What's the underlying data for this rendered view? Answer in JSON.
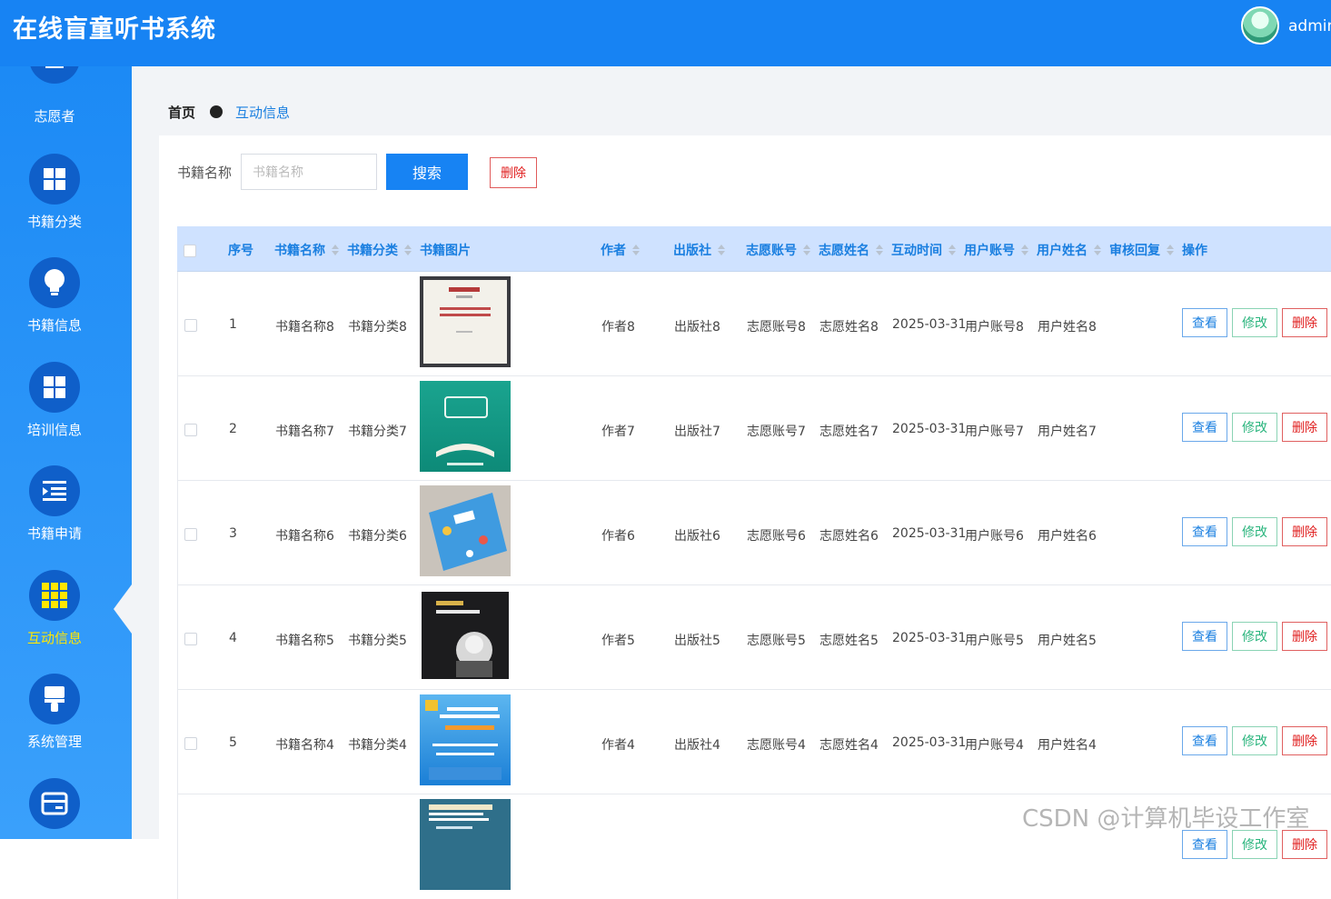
{
  "app": {
    "title": "在线盲童听书系统",
    "user": "admin"
  },
  "sidebar": {
    "items": [
      {
        "label": "志愿者",
        "icon": "volunteer-icon"
      },
      {
        "label": "书籍分类",
        "icon": "grid-icon"
      },
      {
        "label": "书籍信息",
        "icon": "lightbulb-icon"
      },
      {
        "label": "培训信息",
        "icon": "grid-icon"
      },
      {
        "label": "书籍申请",
        "icon": "list-indent-icon"
      },
      {
        "label": "互动信息",
        "icon": "apps-icon",
        "active": true
      },
      {
        "label": "系统管理",
        "icon": "brush-icon"
      },
      {
        "label": "",
        "icon": "card-icon"
      }
    ]
  },
  "breadcrumb": {
    "home": "首页",
    "current": "互动信息"
  },
  "search": {
    "label": "书籍名称",
    "placeholder": "书籍名称",
    "button": "搜索",
    "delete_button": "删除"
  },
  "table": {
    "columns": [
      "序号",
      "书籍名称",
      "书籍分类",
      "书籍图片",
      "作者",
      "出版社",
      "志愿账号",
      "志愿姓名",
      "互动时间",
      "用户账号",
      "用户姓名",
      "审核回复",
      "操作"
    ],
    "actions": {
      "view": "查看",
      "edit": "修改",
      "delete": "删除"
    },
    "rows": [
      {
        "index": "1",
        "name": "书籍名称8",
        "category": "书籍分类8",
        "author": "作者8",
        "publisher": "出版社8",
        "vol_account": "志愿账号8",
        "vol_name": "志愿姓名8",
        "time": "2025-03-31",
        "user_account": "用户账号8",
        "user_name": "用户姓名8",
        "reply": ""
      },
      {
        "index": "2",
        "name": "书籍名称7",
        "category": "书籍分类7",
        "author": "作者7",
        "publisher": "出版社7",
        "vol_account": "志愿账号7",
        "vol_name": "志愿姓名7",
        "time": "2025-03-31",
        "user_account": "用户账号7",
        "user_name": "用户姓名7",
        "reply": ""
      },
      {
        "index": "3",
        "name": "书籍名称6",
        "category": "书籍分类6",
        "author": "作者6",
        "publisher": "出版社6",
        "vol_account": "志愿账号6",
        "vol_name": "志愿姓名6",
        "time": "2025-03-31",
        "user_account": "用户账号6",
        "user_name": "用户姓名6",
        "reply": ""
      },
      {
        "index": "4",
        "name": "书籍名称5",
        "category": "书籍分类5",
        "author": "作者5",
        "publisher": "出版社5",
        "vol_account": "志愿账号5",
        "vol_name": "志愿姓名5",
        "time": "2025-03-31",
        "user_account": "用户账号5",
        "user_name": "用户姓名5",
        "reply": ""
      },
      {
        "index": "5",
        "name": "书籍名称4",
        "category": "书籍分类4",
        "author": "作者4",
        "publisher": "出版社4",
        "vol_account": "志愿账号4",
        "vol_name": "志愿姓名4",
        "time": "2025-03-31",
        "user_account": "用户账号4",
        "user_name": "用户姓名4",
        "reply": ""
      }
    ]
  },
  "watermark": "CSDN @计算机毕设工作室",
  "colors": {
    "primary": "#1783f3",
    "active_menu": "#ffe600",
    "danger": "#e02020",
    "success": "#28b47c"
  }
}
